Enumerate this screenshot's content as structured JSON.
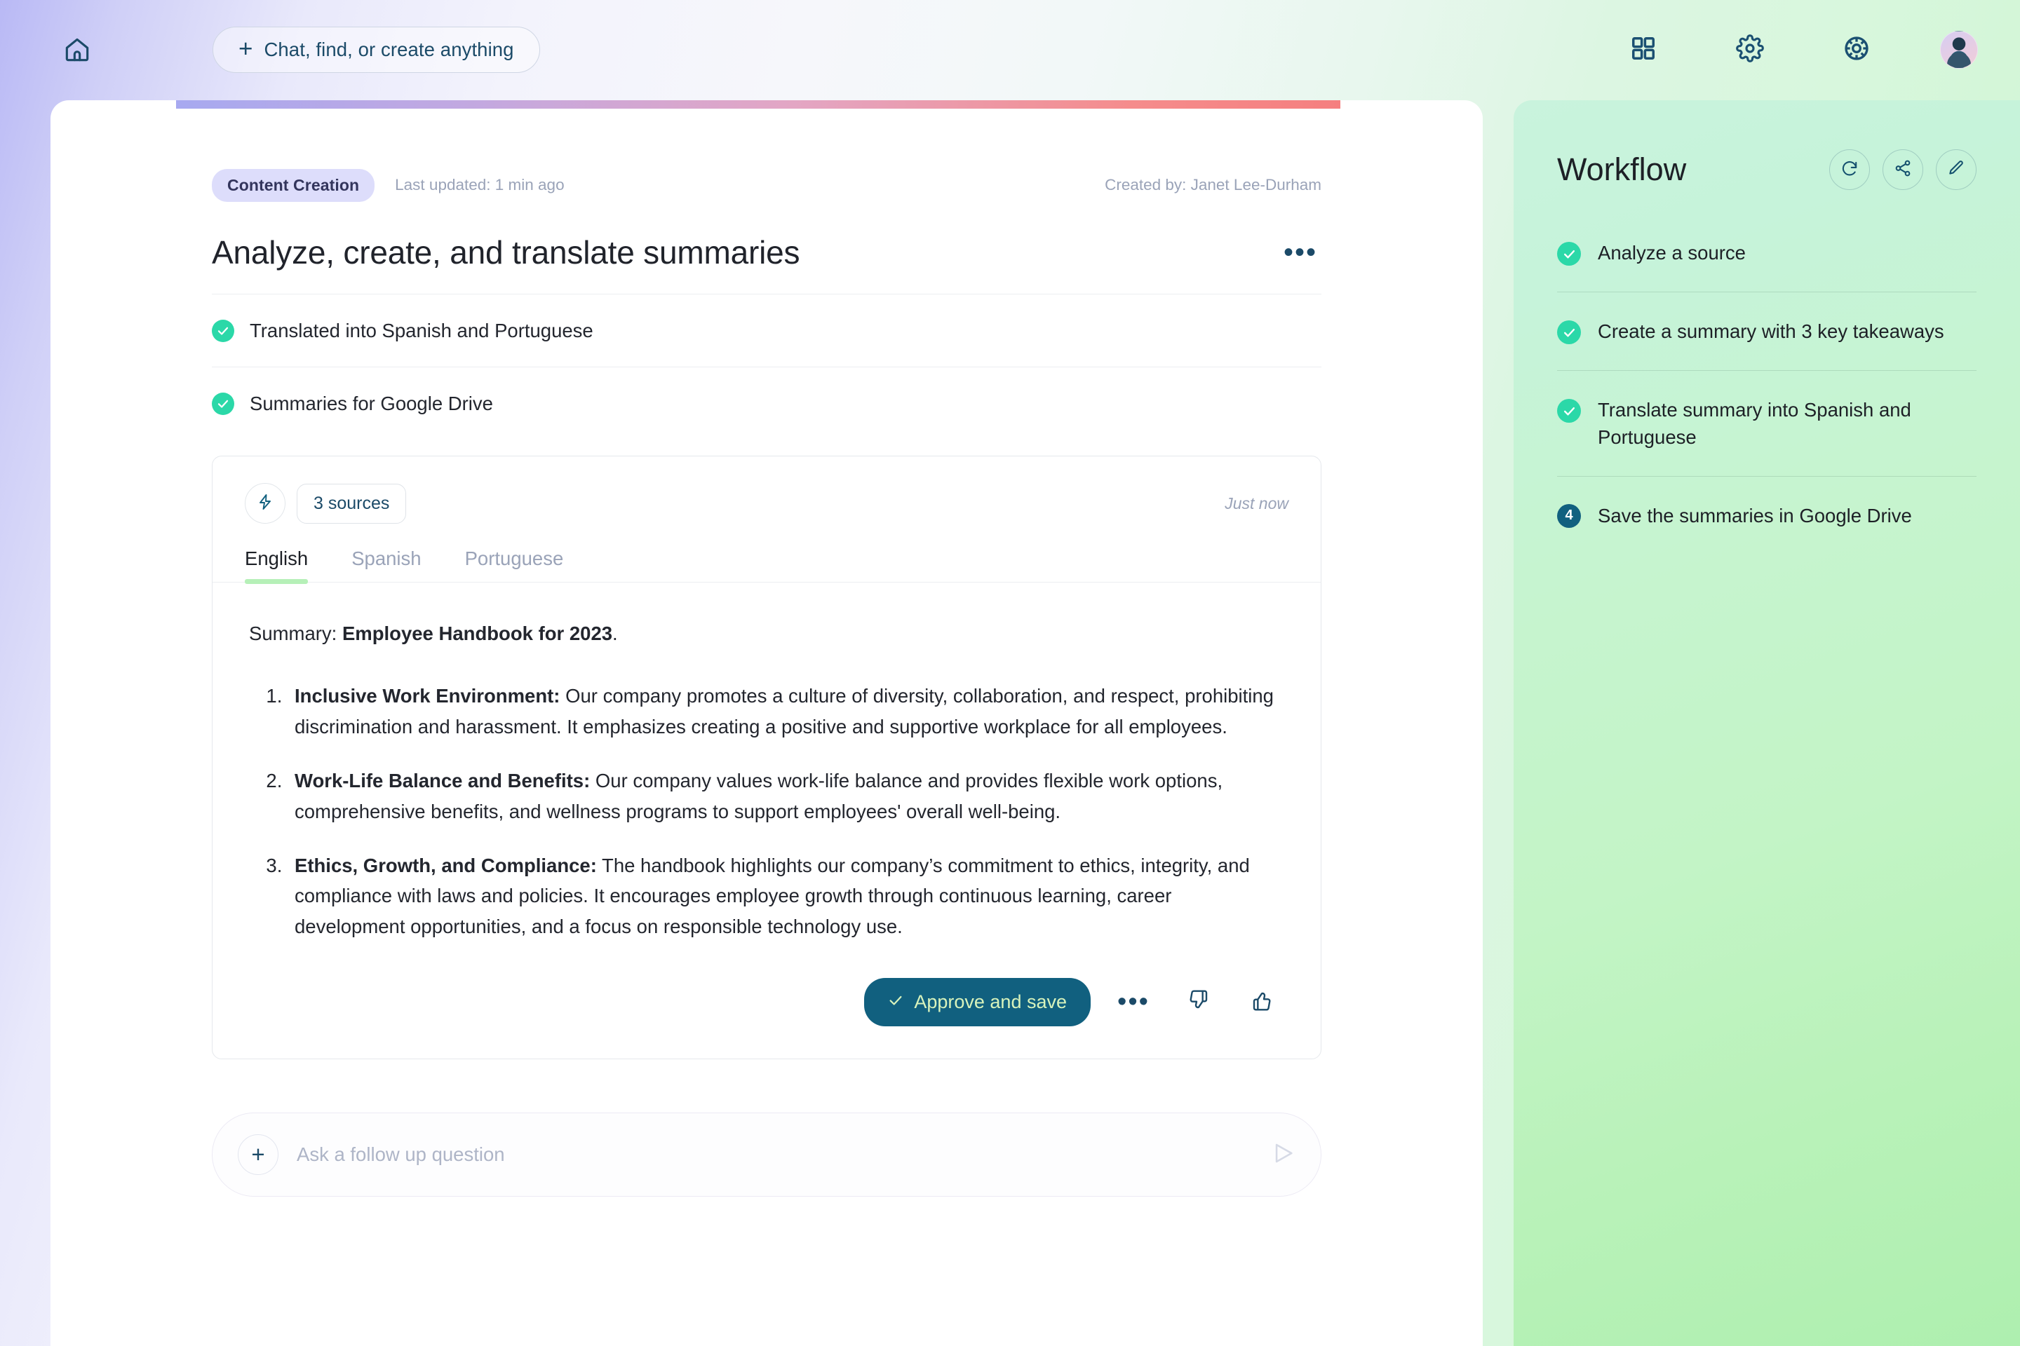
{
  "topbar": {
    "home_icon": "home-icon",
    "omnibox_plus": "+",
    "omnibox_label": "Chat, find, or create anything",
    "icons": [
      "grid-apps-icon",
      "gear-settings-icon",
      "help-wheel-icon"
    ],
    "avatar": "user-avatar"
  },
  "card": {
    "tag": "Content Creation",
    "last_updated": "Last updated: 1 min ago",
    "created_by": "Created by: Janet Lee-Durham",
    "title": "Analyze, create, and translate summaries",
    "menu_dots": "•••",
    "tasks": [
      {
        "label": "Translated into Spanish and Portuguese",
        "state": "done"
      },
      {
        "label": "Summaries for Google Drive",
        "state": "done"
      }
    ]
  },
  "result": {
    "bolt_icon": "lightning-bolt-icon",
    "sources_label": "3 sources",
    "timestamp": "Just now",
    "tabs": [
      {
        "label": "English",
        "active": true
      },
      {
        "label": "Spanish",
        "active": false
      },
      {
        "label": "Portuguese",
        "active": false
      }
    ],
    "summary_prefix": "Summary: ",
    "summary_doc": "Employee Handbook for 2023",
    "summary_suffix": ".",
    "takeaways": [
      {
        "heading": "Inclusive Work Environment:",
        "body": " Our company promotes a culture of diversity, collaboration, and respect, prohibiting discrimination and harassment. It emphasizes creating a positive and supportive workplace for all employees."
      },
      {
        "heading": "Work-Life Balance and Benefits:",
        "body": " Our company values work-life balance and provides flexible work options, comprehensive benefits, and wellness programs to support employees' overall well-being."
      },
      {
        "heading": "Ethics, Growth, and Compliance:",
        "body": " The handbook highlights our company’s commitment to ethics, integrity, and compliance with laws and policies. It encourages employee growth through continuous learning, career development opportunities, and a focus on responsible technology use."
      }
    ],
    "approve_label": "Approve and save",
    "more_dots": "•••",
    "thumbs_down_icon": "thumbs-down-icon",
    "thumbs_up_icon": "thumbs-up-icon"
  },
  "followup": {
    "plus": "+",
    "placeholder": "Ask a follow up question",
    "send_icon": "send-icon"
  },
  "workflow": {
    "title": "Workflow",
    "actions": [
      "refresh-icon",
      "share-icon",
      "edit-pencil-icon"
    ],
    "steps": [
      {
        "label": "Analyze a source",
        "state": "done",
        "number": "1"
      },
      {
        "label": "Create a summary with 3 key takeaways",
        "state": "done",
        "number": "2"
      },
      {
        "label": "Translate summary into Spanish and Portuguese",
        "state": "done",
        "number": "3"
      },
      {
        "label": "Save the summaries in Google Drive",
        "state": "current",
        "number": "4"
      }
    ]
  },
  "colors": {
    "accent_teal": "#11607f",
    "check_green": "#2bd8a8",
    "tag_purple": "#ddddfb",
    "tab_underline": "#b6f0b8",
    "approve_text": "#d8f3bc"
  }
}
